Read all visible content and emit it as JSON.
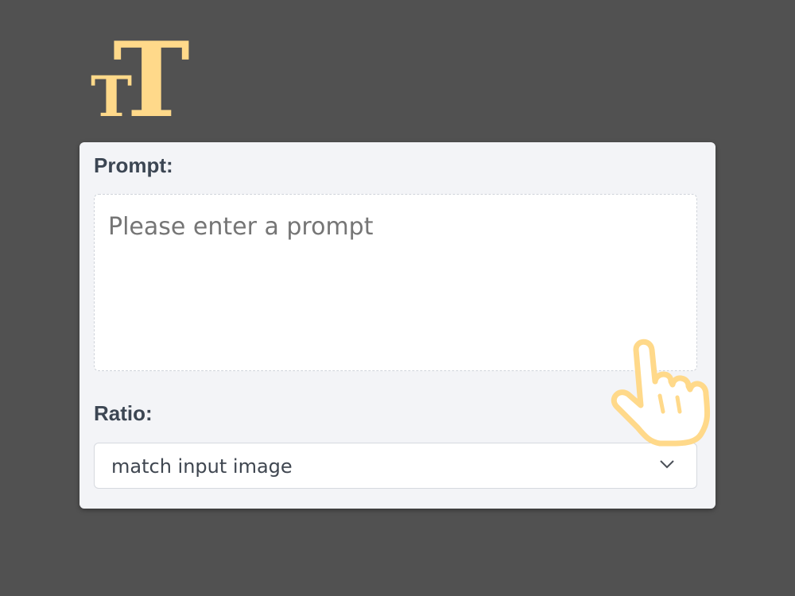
{
  "logo": {
    "glyphs": [
      "T",
      "T"
    ],
    "color": "#ffd98a"
  },
  "form": {
    "prompt_label": "Prompt:",
    "prompt_placeholder": "Please enter a prompt",
    "prompt_value": "",
    "ratio_label": "Ratio:",
    "ratio_selected": "match input image"
  },
  "icons": {
    "logo": "text-size-icon",
    "chevron": "chevron-down-icon",
    "pointer": "hand-pointer-icon"
  },
  "colors": {
    "background": "#515151",
    "card": "#f3f4f7",
    "label": "#3c4653",
    "placeholder": "#a8acb3",
    "accent": "#ffd98a"
  }
}
